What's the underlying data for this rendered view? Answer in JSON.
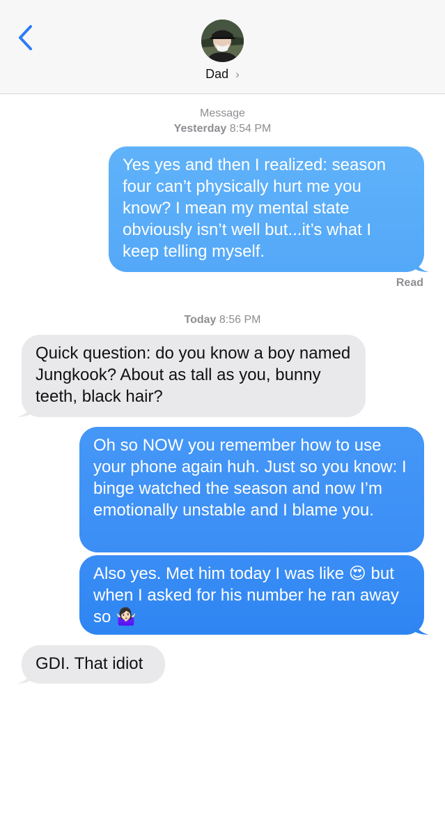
{
  "header": {
    "contact_name": "Dad",
    "chevron": "›"
  },
  "colors": {
    "outgoing_top": "#5cb0f8",
    "outgoing_bottom": "#2b84f1",
    "incoming": "#e9e9eb",
    "accent": "#2d7cf6"
  },
  "thread": {
    "timestamp1": {
      "label": "Message",
      "day": "Yesterday",
      "time": "8:54 PM"
    },
    "msg1": "Yes yes and then I realized: season four can’t physically hurt me you know? I mean my mental state obviously isn’t well but...it’s what I keep telling myself.",
    "read_receipt": "Read",
    "timestamp2": {
      "day": "Today",
      "time": "8:56 PM"
    },
    "msg2": "Quick question: do you know a boy named Jungkook? About as tall as you, bunny teeth, black hair?",
    "msg3": "Oh so NOW you remember how to use your phone again huh. Just so you know: I binge watched the season and now I’m emotionally unstable and I blame you.",
    "msg4_part1": "Also yes. Met him today I was like ",
    "msg4_emoji1": "😍",
    "msg4_part2": " but when I asked for his number he ran away so ",
    "msg4_emoji2": "🤷🏻‍♀️",
    "msg5": "GDI. That idiot"
  }
}
